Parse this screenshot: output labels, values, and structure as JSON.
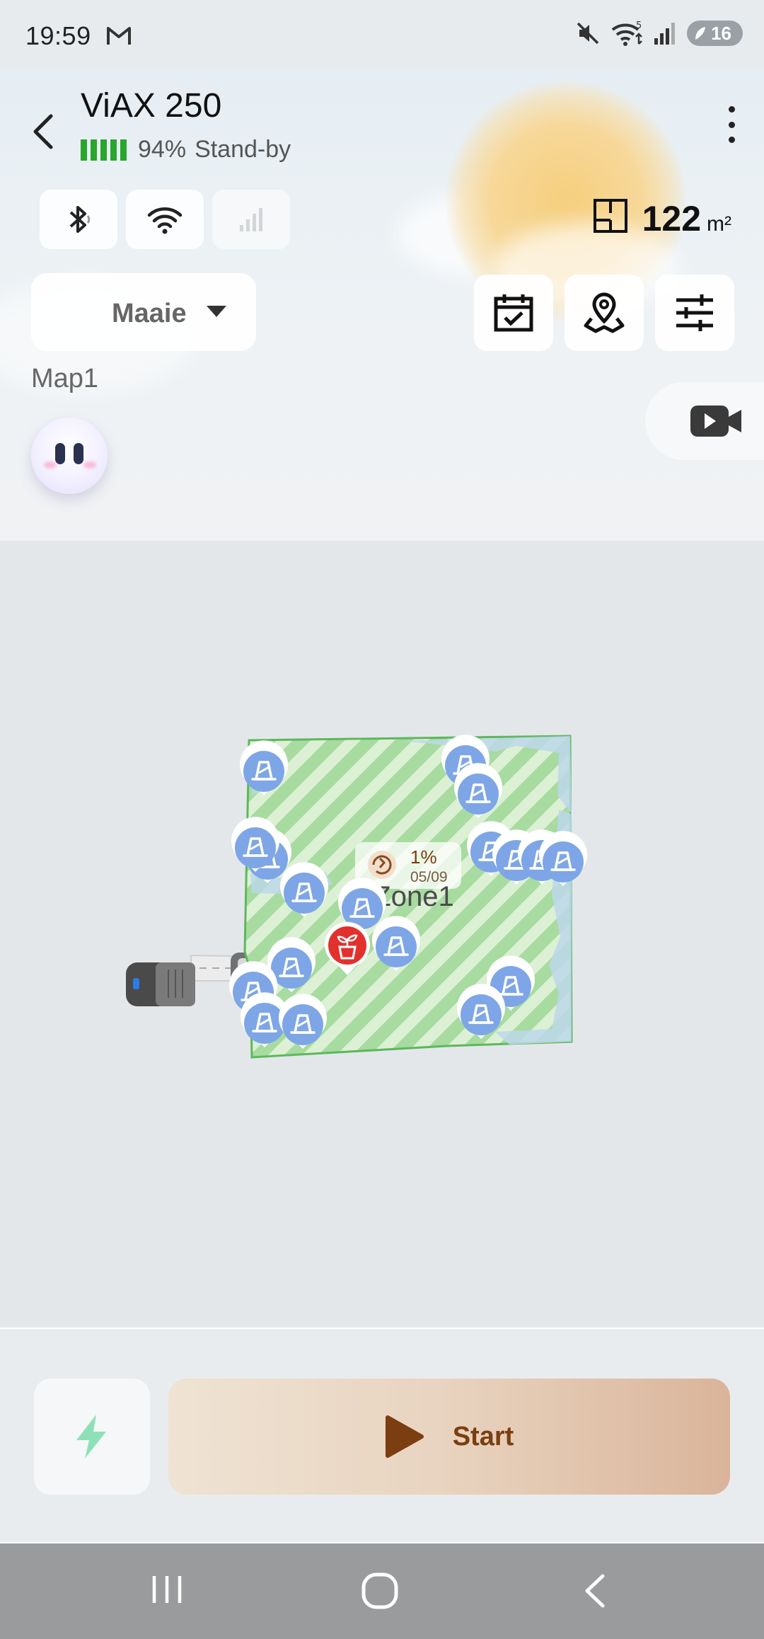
{
  "status_bar": {
    "time": "19:59",
    "battery_level": "16",
    "icons": [
      "gmail-icon",
      "mute-icon",
      "wifi-icon",
      "signal-icon",
      "battery-icon"
    ]
  },
  "header": {
    "device_name": "ViAX 250",
    "battery_percent": "94%",
    "status": "Stand-by",
    "area_value": "122",
    "area_unit": "m²",
    "mode": "Maaie",
    "map_name": "Map1"
  },
  "map": {
    "zone_name": "Zone1",
    "progress": "1%",
    "date": "05/09"
  },
  "bottom": {
    "start_label": "Start"
  },
  "colors": {
    "zone_fill": "#a9dba0",
    "zone_border": "#5cb85c",
    "obstacle_blue": "#7ea6e6",
    "plant_red": "#e2312d",
    "start_text": "#7a3e10"
  }
}
